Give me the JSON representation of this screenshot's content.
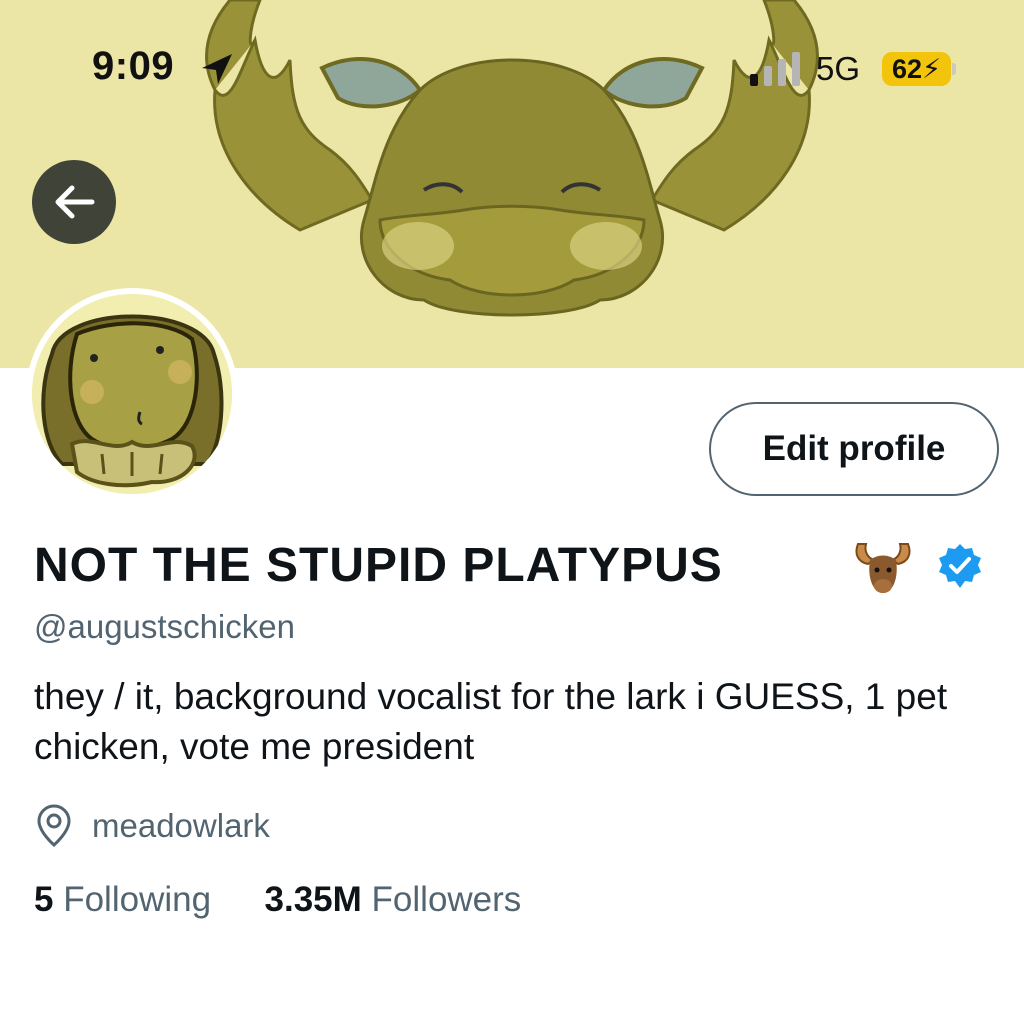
{
  "status_bar": {
    "time": "9:09",
    "network": "5G",
    "battery": "62"
  },
  "profile": {
    "display_name": "NOT THE STUPID PLATYPUS",
    "handle": "@augustschicken",
    "bio": "they / it, background vocalist for the lark i GUESS, 1 pet chicken, vote me president",
    "location": "meadowlark",
    "following_count": "5",
    "following_label": "Following",
    "followers_count": "3.35M",
    "followers_label": "Followers",
    "verified": true
  },
  "actions": {
    "edit_profile_label": "Edit profile"
  },
  "colors": {
    "banner_bg": "#ece6a6",
    "moose": "#8f8a33",
    "secondary_text": "#536471",
    "verified_blue": "#1d9bf0",
    "battery_yellow": "#f2c40b"
  },
  "icons": {
    "back": "arrow-left-icon",
    "location_services": "location-arrow-icon",
    "signal": "cellular-signal-icon",
    "verified": "verified-badge-icon",
    "location": "map-pin-icon"
  }
}
